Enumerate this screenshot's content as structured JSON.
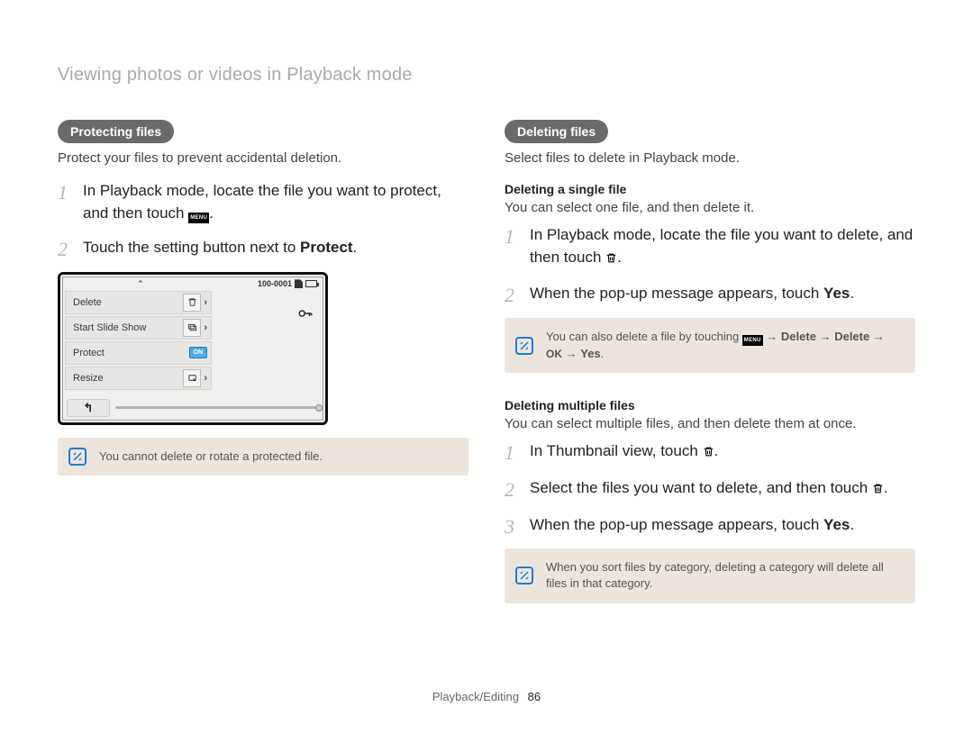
{
  "header": {
    "breadcrumb": "Viewing photos or videos in Playback mode"
  },
  "footer": {
    "section": "Playback/Editing",
    "page": "86"
  },
  "left": {
    "pill": "Protecting files",
    "lead": "Protect your files to prevent accidental deletion.",
    "steps": {
      "s1a": "In Playback mode, locate the file you want to protect, and then touch ",
      "s1b": ".",
      "s2a": "Touch the setting button next to ",
      "s2b": "Protect",
      "s2c": "."
    },
    "device": {
      "counter": "100-0001",
      "caret_up": "⌃",
      "menu": {
        "delete": "Delete",
        "slideshow": "Start Slide Show",
        "protect": "Protect",
        "resize": "Resize",
        "on": "ON"
      },
      "back_glyph": "↰"
    },
    "note": "You cannot delete or rotate a protected file."
  },
  "right": {
    "pill": "Deleting files",
    "lead": "Select files to delete in Playback mode.",
    "single": {
      "title": "Deleting a single file",
      "lead": "You can select one file, and then delete it.",
      "steps": {
        "s1a": "In Playback mode, locate the file you want to delete, and then touch ",
        "s1b": ".",
        "s2a": "When the pop-up message appears, touch ",
        "s2b": "Yes",
        "s2c": "."
      },
      "note_a": "You can also delete a file by touching ",
      "note_b": " → ",
      "note_del": "Delete",
      "note_ok": "OK",
      "note_yes": "Yes",
      "note_dot": "."
    },
    "multi": {
      "title": "Deleting multiple files",
      "lead": "You can select multiple files, and then delete them at once.",
      "steps": {
        "s1a": "In Thumbnail view, touch ",
        "s1b": ".",
        "s2a": "Select the files you want to delete, and then touch ",
        "s2b": ".",
        "s3a": "When the pop-up message appears, touch ",
        "s3b": "Yes",
        "s3c": "."
      },
      "note": "When you sort files by category, deleting a category will delete all files in that category."
    }
  }
}
